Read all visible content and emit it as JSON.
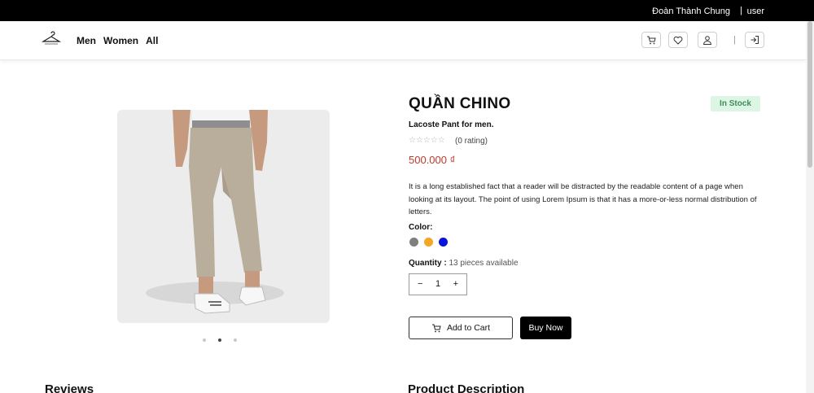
{
  "topbar": {
    "user_name": "Đoàn Thành Chung",
    "separator": "|",
    "user_role": "user"
  },
  "nav": {
    "links": [
      "Men",
      "Women",
      "All"
    ],
    "icons": [
      "cart-icon",
      "heart-icon",
      "user-icon",
      "logout-icon"
    ],
    "separator": "|"
  },
  "product": {
    "title": "QUẦN CHINO",
    "stock_status": "In Stock",
    "subtitle": "Lacoste Pant for men.",
    "stars": "☆☆☆☆☆",
    "rating_text": "(0 rating)",
    "price": "500.000 ₫",
    "description": "It is a long established fact that a reader will be distracted by the readable content of a page when looking at its layout. The point of using Lorem Ipsum is that it has a more-or-less normal distribution of letters.",
    "color_label": "Color:",
    "colors": [
      "#7f7f7f",
      "#f5a623",
      "#0a14d8"
    ],
    "quantity_label": "Quantity :",
    "quantity_available": "13 pieces available",
    "quantity_value": "1",
    "minus": "−",
    "plus": "+",
    "add_to_cart": "Add to Cart",
    "buy_now": "Buy Now"
  },
  "carousel": {
    "slides": 3,
    "active_index": 2
  },
  "sections": {
    "reviews": "Reviews",
    "description": "Product Description"
  },
  "colors": {
    "stock_bg": "#dcf5e4",
    "stock_text": "#3e8e57",
    "price": "#c0392b"
  }
}
